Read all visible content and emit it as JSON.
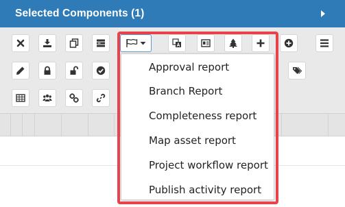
{
  "panel": {
    "title": "Selected Components (1)"
  },
  "toolbar": {
    "rows": [
      [
        {
          "name": "remove-button",
          "icon": "close-icon"
        },
        {
          "name": "download-button",
          "icon": "download-icon"
        },
        {
          "name": "copy-button",
          "icon": "copy-icon"
        },
        {
          "name": "list-view-button",
          "icon": "list-icon"
        },
        {
          "name": "reports-dropdown-button",
          "icon": "flag-icon"
        },
        {
          "name": "translate-button",
          "icon": "translate-icon"
        },
        {
          "name": "card-view-button",
          "icon": "card-icon"
        },
        {
          "name": "tree-button",
          "icon": "tree-icon"
        },
        {
          "name": "add-button",
          "icon": "plus-icon"
        },
        {
          "name": "add-circle-button",
          "icon": "plus-circle-icon"
        },
        {
          "name": "menu-button",
          "icon": "hamburger-icon"
        }
      ],
      [
        {
          "name": "edit-button",
          "icon": "pencil-icon"
        },
        {
          "name": "lock-button",
          "icon": "lock-icon"
        },
        {
          "name": "unlock-button",
          "icon": "unlock-icon"
        },
        {
          "name": "approve-button",
          "icon": "check-circle-icon"
        },
        {
          "name": "tags-button",
          "icon": "tags-icon"
        }
      ],
      [
        {
          "name": "table-button",
          "icon": "table-icon"
        },
        {
          "name": "users-button",
          "icon": "users-icon"
        },
        {
          "name": "link-button",
          "icon": "link-icon"
        },
        {
          "name": "unlink-button",
          "icon": "link-alt-icon"
        }
      ]
    ]
  },
  "reports_menu": {
    "items": [
      "Approval report",
      "Branch Report",
      "Completeness report",
      "Map asset report",
      "Project workflow report",
      "Publish activity report"
    ]
  },
  "colors": {
    "header": "#2f7bb8",
    "highlight": "#e8424a",
    "icon": "#333333",
    "toolbar_bg": "#e9e9e9"
  }
}
